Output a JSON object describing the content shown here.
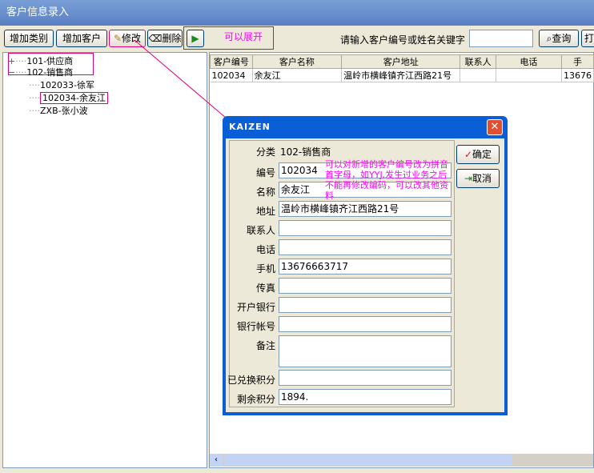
{
  "window": {
    "title": "客户信息录入"
  },
  "toolbar": {
    "add_category": "增加类别",
    "add_customer": "增加客户",
    "edit": "修改",
    "delete": "删除",
    "expand_annotation": "可以展开",
    "search_label": "请输入客户编号或姓名关键字",
    "search_value": "",
    "query": "查询",
    "print": "打"
  },
  "tree": {
    "nodes": [
      {
        "label": "101-供应商",
        "expander": "+"
      },
      {
        "label": "102-销售商",
        "expander": "−"
      }
    ],
    "children": [
      "102033-徐军",
      "102034-余友江",
      "ZXB-张小波"
    ]
  },
  "grid": {
    "columns": [
      "客户编号",
      "客户名称",
      "客户地址",
      "联系人",
      "电话",
      "手"
    ],
    "rows": [
      [
        "102034",
        "余友江",
        "温岭市横峰镇齐江西路21号",
        "",
        "",
        "13676"
      ]
    ]
  },
  "dialog": {
    "title": "KAIZEN",
    "close": "✕",
    "category_label": "分类",
    "category_value": "102-销售商",
    "ok": "确定",
    "cancel": "取消",
    "annotation": "可以对新增的客户编号改为拼音首字母，如YYJ,发生过业务之后不能再修改编码，可以改其他资料",
    "fields": [
      {
        "label": "编号",
        "value": "102034"
      },
      {
        "label": "名称",
        "value": "余友江"
      },
      {
        "label": "地址",
        "value": "温岭市横峰镇齐江西路21号"
      },
      {
        "label": "联系人",
        "value": ""
      },
      {
        "label": "电话",
        "value": ""
      },
      {
        "label": "手机",
        "value": "13676663717"
      },
      {
        "label": "传真",
        "value": ""
      },
      {
        "label": "开户银行",
        "value": ""
      },
      {
        "label": "银行帐号",
        "value": ""
      },
      {
        "label": "备注",
        "value": ""
      },
      {
        "label": "已兑换积分",
        "value": ""
      },
      {
        "label": "剩余积分",
        "value": "1894."
      }
    ]
  },
  "colors": {
    "annotation": "#ff00ff",
    "title_bar": "#5a80c4",
    "dialog_frame": "#0a5fd6"
  }
}
